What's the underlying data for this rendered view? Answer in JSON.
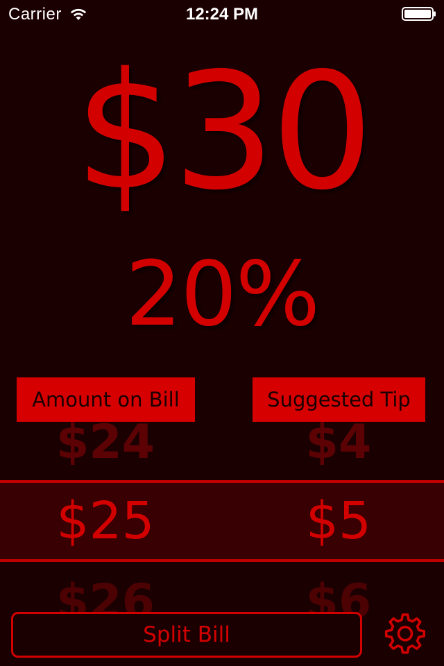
{
  "status_bar": {
    "carrier": "Carrier",
    "time": "12:24 PM",
    "wifi_icon": "wifi-icon",
    "battery_icon": "battery-icon"
  },
  "summary": {
    "total": "$30",
    "tip_percent": "20%"
  },
  "columns": {
    "amount_label": "Amount on Bill",
    "tip_label": "Suggested Tip"
  },
  "picker": {
    "rows": [
      {
        "amount": "$24",
        "tip": "$4"
      },
      {
        "amount": "$25",
        "tip": "$5"
      },
      {
        "amount": "$26",
        "tip": "$6"
      }
    ],
    "selected_index": 1
  },
  "actions": {
    "split_bill_label": "Split Bill",
    "settings_icon": "gear-icon"
  },
  "colors": {
    "accent": "#d30000",
    "background": "#1b0002",
    "selected_row": "#380002"
  }
}
